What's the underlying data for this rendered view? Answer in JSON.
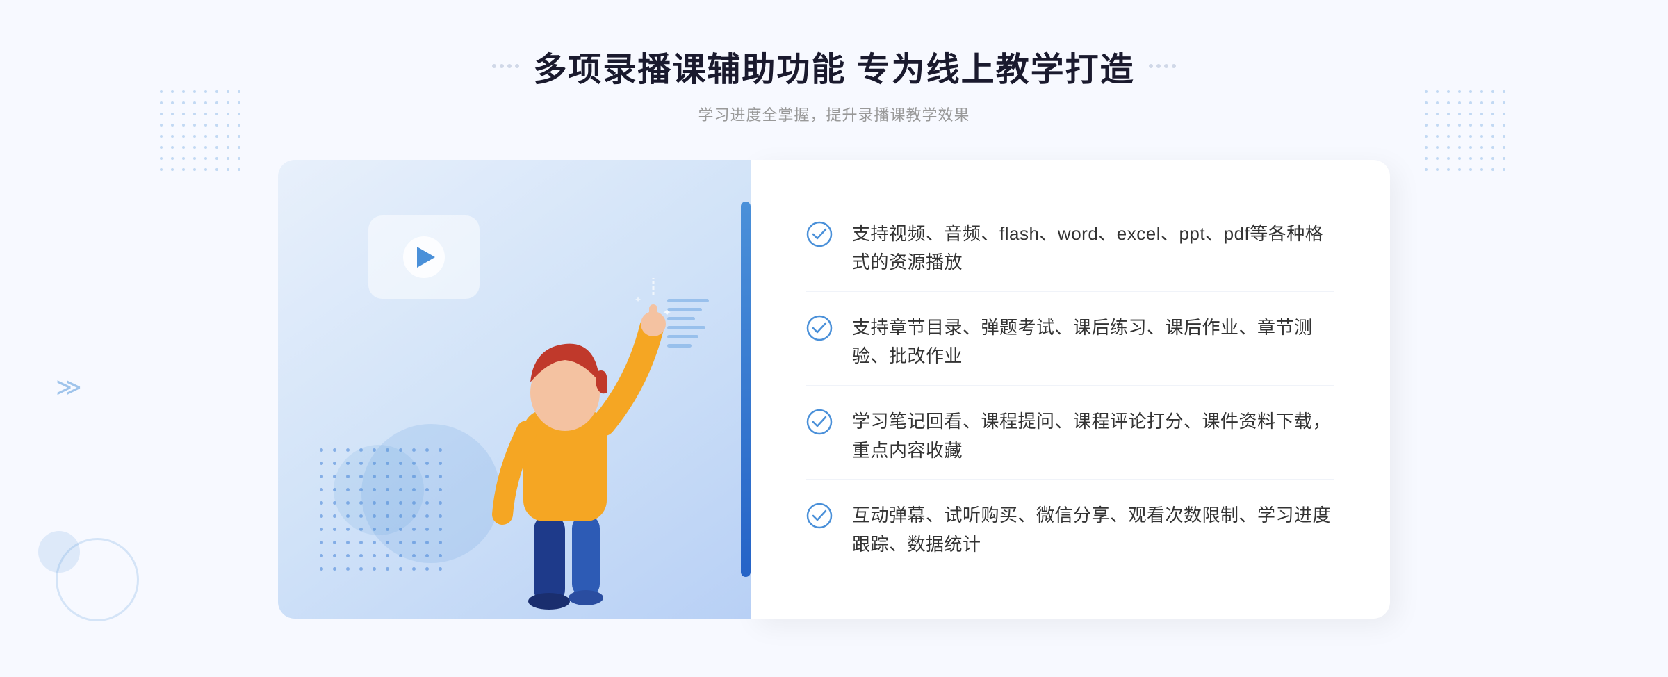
{
  "header": {
    "title": "多项录播课辅助功能 专为线上教学打造",
    "subtitle": "学习进度全掌握，提升录播课教学效果",
    "deco_dots_count": 2
  },
  "features": [
    {
      "id": 1,
      "text": "支持视频、音频、flash、word、excel、ppt、pdf等各种格式的资源播放"
    },
    {
      "id": 2,
      "text": "支持章节目录、弹题考试、课后练习、课后作业、章节测验、批改作业"
    },
    {
      "id": 3,
      "text": "学习笔记回看、课程提问、课程评论打分、课件资料下载，重点内容收藏"
    },
    {
      "id": 4,
      "text": "互动弹幕、试听购买、微信分享、观看次数限制、学习进度跟踪、数据统计"
    }
  ],
  "colors": {
    "primary": "#4a90d9",
    "title": "#1a1a2e",
    "text": "#333333",
    "subtitle": "#999999",
    "check": "#4a90d9"
  }
}
